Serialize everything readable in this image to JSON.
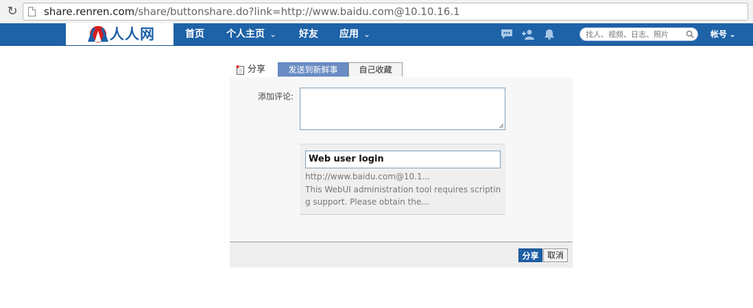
{
  "browser": {
    "url_host": "share.renren.com",
    "url_path": "/share/buttonshare.do?link=http://www.baidu.com@10.10.16.1"
  },
  "header": {
    "logo_text": "人人网",
    "nav": [
      {
        "label": "首页"
      },
      {
        "label": "个人主页",
        "chevron": "⌄"
      },
      {
        "label": "好友"
      },
      {
        "label": "应用",
        "chevron": "⌄"
      }
    ],
    "icons": [
      "chat-icon",
      "add-friend-icon",
      "notification-bell-icon"
    ],
    "search_placeholder": "找人、视频、日志、照片",
    "account_label": "帐号",
    "account_chevron": "⌄",
    "colors": {
      "bar": "#1e62a7",
      "logo": "#1e62a7"
    }
  },
  "share": {
    "title": "分享",
    "tabs": [
      "发送到新鲜事",
      "自己收藏"
    ],
    "comment_label": "添加评论:",
    "comment_value": "",
    "preview": {
      "title": "Web user login",
      "url": "http://www.baidu.com@10.1...",
      "description": "This WebUI administration tool requires scripting support. Please obtain the..."
    },
    "buttons": {
      "share": "分享",
      "cancel": "取消"
    },
    "colors": {
      "active_tab": "#6a8cc3",
      "share_button": "#1e5fa6"
    }
  }
}
